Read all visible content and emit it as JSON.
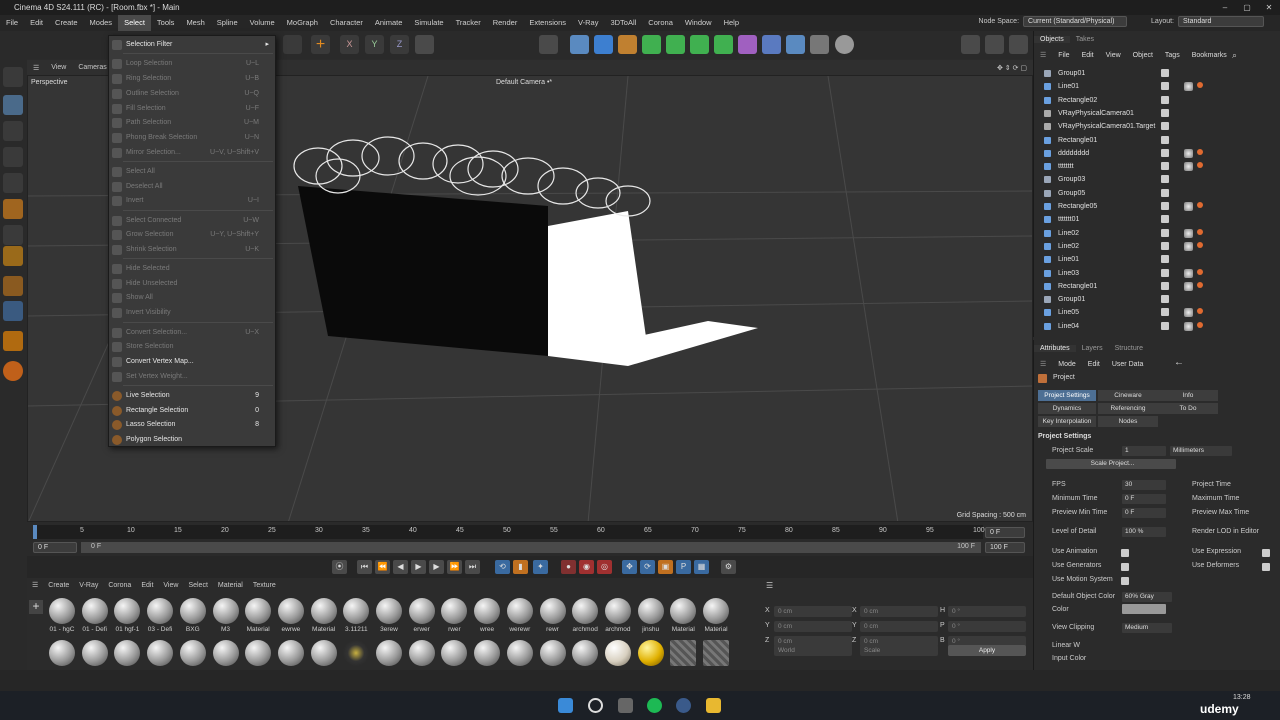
{
  "window": {
    "title": "Cinema 4D S24.111 (RC) - [Room.fbx *] - Main"
  },
  "menubar": [
    "File",
    "Edit",
    "Create",
    "Modes",
    "Select",
    "Tools",
    "Mesh",
    "Spline",
    "Volume",
    "MoGraph",
    "Character",
    "Animate",
    "Simulate",
    "Tracker",
    "Render",
    "Extensions",
    "V-Ray",
    "3DToAll",
    "Corona",
    "Window",
    "Help"
  ],
  "nodespace": {
    "label": "Node Space:",
    "value": "Current (Standard/Physical)",
    "layout_label": "Layout:",
    "layout_value": "Standard"
  },
  "viewport": {
    "menu": [
      "View",
      "Cameras"
    ],
    "label": "Perspective",
    "camera": "Default Camera •*",
    "grid": "Grid Spacing : 500 cm"
  },
  "select_menu": {
    "filter": "Selection Filter",
    "items": [
      {
        "label": "Loop Selection",
        "shortcut": "U~L"
      },
      {
        "label": "Ring Selection",
        "shortcut": "U~B"
      },
      {
        "label": "Outline Selection",
        "shortcut": "U~Q"
      },
      {
        "label": "Fill Selection",
        "shortcut": "U~F"
      },
      {
        "label": "Path Selection",
        "shortcut": "U~M"
      },
      {
        "label": "Phong Break Selection",
        "shortcut": "U~N"
      },
      {
        "label": "Mirror Selection...",
        "shortcut": "U~V, U~Shift+V"
      },
      {
        "label": "Select All",
        "shortcut": ""
      },
      {
        "label": "Deselect All",
        "shortcut": ""
      },
      {
        "label": "Invert",
        "shortcut": "U~I"
      },
      {
        "label": "Select Connected",
        "shortcut": "U~W"
      },
      {
        "label": "Grow Selection",
        "shortcut": "U~Y, U~Shift+Y"
      },
      {
        "label": "Shrink Selection",
        "shortcut": "U~K"
      },
      {
        "label": "Hide Selected",
        "shortcut": ""
      },
      {
        "label": "Hide Unselected",
        "shortcut": ""
      },
      {
        "label": "Show All",
        "shortcut": ""
      },
      {
        "label": "Invert Visibility",
        "shortcut": ""
      },
      {
        "label": "Convert Selection...",
        "shortcut": "U~X"
      },
      {
        "label": "Store Selection",
        "shortcut": ""
      },
      {
        "label": "Convert Vertex Map...",
        "shortcut": ""
      },
      {
        "label": "Set Vertex Weight...",
        "shortcut": ""
      },
      {
        "label": "Live Selection",
        "shortcut": "9"
      },
      {
        "label": "Rectangle Selection",
        "shortcut": "0"
      },
      {
        "label": "Lasso Selection",
        "shortcut": "8"
      },
      {
        "label": "Polygon Selection",
        "shortcut": ""
      }
    ]
  },
  "timeline": {
    "ticks": [
      "0",
      "5",
      "10",
      "15",
      "20",
      "25",
      "30",
      "35",
      "40",
      "45",
      "50",
      "55",
      "60",
      "65",
      "70",
      "75",
      "80",
      "85",
      "90",
      "95",
      "100"
    ],
    "current": "0 F",
    "start": "0 F",
    "start2": "0 F",
    "end": "100 F",
    "end2": "100 F"
  },
  "materials": {
    "menu": [
      "Create",
      "V-Ray",
      "Corona",
      "Edit",
      "View",
      "Select",
      "Material",
      "Texture"
    ],
    "row1": [
      "01 - hgC",
      "01 - Defi",
      "01 hgf-1",
      "03 - Defi",
      "BXG",
      "M3",
      "Material",
      "ewrwe",
      "Material",
      "3.11211",
      "3erew",
      "erwer",
      "rwer",
      "wree",
      "werewr",
      "rewr",
      "archmod",
      "archmod",
      "jinshu",
      "Material",
      "Material"
    ]
  },
  "coords": {
    "x": "X",
    "y": "Y",
    "z": "Z",
    "h": "H",
    "p": "P",
    "b": "B",
    "pos": "0 cm",
    "ang": "0 °",
    "world": "World",
    "scale": "Scale",
    "apply": "Apply"
  },
  "objects": {
    "tabs": [
      "Objects",
      "Takes"
    ],
    "menu": [
      "File",
      "Edit",
      "View",
      "Object",
      "Tags",
      "Bookmarks"
    ],
    "rows": [
      "Group01",
      "Line01",
      "Rectangle02",
      "VRayPhysicalCamera01",
      "VRayPhysicalCamera01.Target",
      "Rectangle01",
      "dddddddd",
      "tttttttt",
      "Group03",
      "Group05",
      "Rectangle05",
      "ttttttt01",
      "Line02",
      "Line02",
      "Line01",
      "Line03",
      "Rectangle01",
      "Group01",
      "Line05",
      "Line04"
    ]
  },
  "attributes": {
    "tabs": [
      "Attributes",
      "Layers",
      "Structure"
    ],
    "menu": [
      "Mode",
      "Edit",
      "User Data"
    ],
    "object": "Project",
    "ptabs": [
      "Project Settings",
      "Cineware",
      "Info",
      "Dynamics",
      "Referencing",
      "To Do",
      "Key Interpolation",
      "Nodes"
    ],
    "section": "Project Settings",
    "project_scale": "Project Scale",
    "scale_val": "1",
    "scale_unit": "Millimeters",
    "scale_btn": "Scale Project...",
    "fps": "FPS",
    "fps_val": "30",
    "ptime": "Project Time",
    "mintime": "Minimum Time",
    "mintime_val": "0 F",
    "maxtime": "Maximum Time",
    "pmin": "Preview Min Time",
    "pmin_val": "0 F",
    "pmax": "Preview Max Time",
    "lod": "Level of Detail",
    "lod_val": "100 %",
    "rlod": "Render LOD in Editor",
    "useanim": "Use Animation",
    "useexpr": "Use Expression",
    "usegen": "Use Generators",
    "usedef": "Use Deformers",
    "usemotion": "Use Motion System",
    "defcolor": "Default Object Color",
    "defcolor_val": "60% Gray",
    "color": "Color",
    "viewclip": "View Clipping",
    "viewclip_val": "Medium",
    "linear": "Linear W",
    "input": "Input Color"
  },
  "taskbar": {
    "time": "13:28",
    "brand": "udemy"
  }
}
